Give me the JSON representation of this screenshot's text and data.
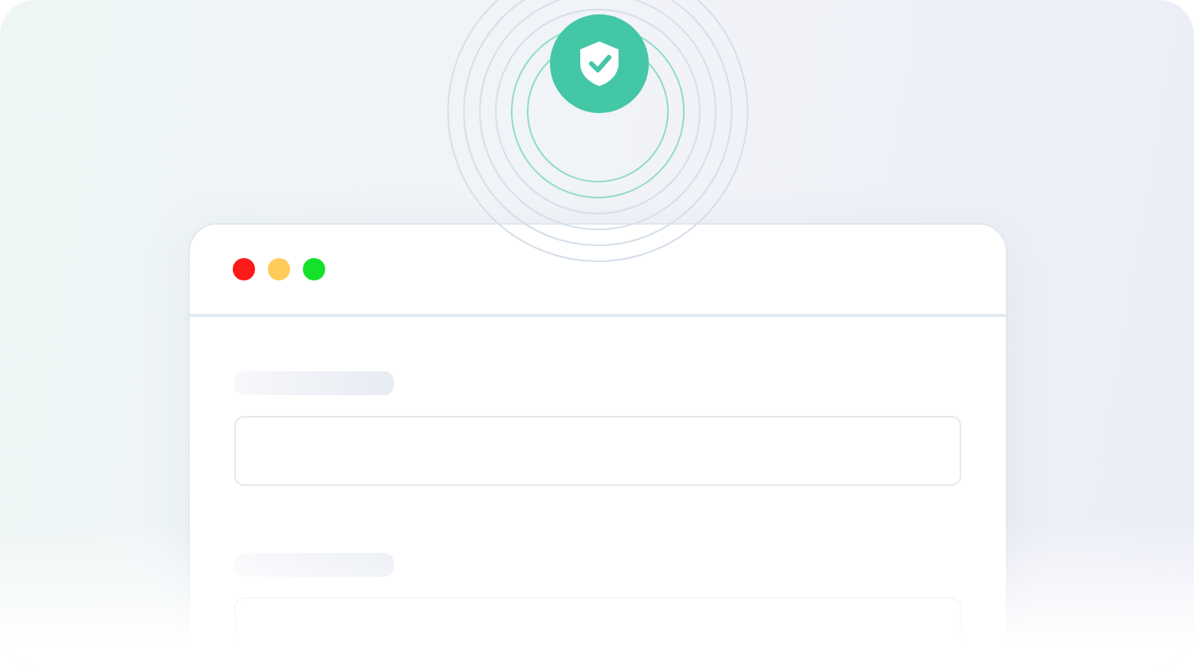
{
  "window": {
    "controls": [
      {
        "color": "#ff1a1a"
      },
      {
        "color": "#ffcc5c"
      },
      {
        "color": "#14e22a"
      }
    ]
  },
  "form": {
    "fields": [
      {
        "kind": "text"
      },
      {
        "kind": "text"
      }
    ]
  }
}
